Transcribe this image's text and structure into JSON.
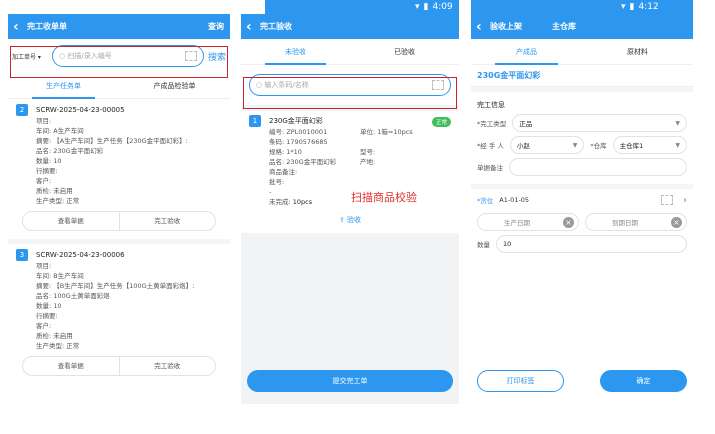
{
  "panel1": {
    "title": "完工收单单",
    "right_action": "查询",
    "dropdown": "加工单号",
    "search_placeholder": "扫描/录入编号",
    "search_btn": "搜索",
    "tabs": [
      "生产任务单",
      "产成品检验单"
    ],
    "cards": [
      {
        "index": "2",
        "code": "SCRW-2025-04-23-00005",
        "lines": [
          "项目:",
          "车间: A生产车间",
          "摘要: 【A生产车间】生产任务【230G金平面幻彩】:",
          "品名: 230G金平面幻彩",
          "数量: 10",
          "行摘要:",
          "客户:",
          "质检: 未启用",
          "生产类型: 正常"
        ],
        "btn_view": "查看单据",
        "btn_accept": "完工验收"
      },
      {
        "index": "3",
        "code": "SCRW-2025-04-23-00006",
        "lines": [
          "项目:",
          "车间: B生产车间",
          "摘要: 【B生产车间】生产任务【100G土黄单面彩烙】:",
          "品名: 100G土黄单面彩烙",
          "数量: 10",
          "行摘要:",
          "客户:",
          "质检: 未启用",
          "生产类型: 正常"
        ],
        "btn_view": "查看单据",
        "btn_accept": "完工验收"
      }
    ]
  },
  "panel2": {
    "status_time": "4:09",
    "title": "完工验收",
    "tabs": [
      "未验收",
      "已验收"
    ],
    "search_placeholder": "输入条码/名称",
    "item": {
      "index": "1",
      "name": "230G金平面幻彩",
      "tag": "正常",
      "code_label": "编号: ZPL0010001",
      "unit_label": "单位: 1箱=10pcs",
      "barcode": "条码: 1790576685",
      "spec": "规格: 1*10",
      "model": "型号:",
      "pname": "品名: 230G金平面幻彩",
      "origin": "产地:",
      "remark": "商品备注:",
      "batch": "批号:",
      "dash": "-",
      "unfinished_label": "未完成:",
      "unfinished_value": "10pcs"
    },
    "annotation": "扫描商品校验",
    "receive_link": "验收",
    "submit_btn": "提交完工单"
  },
  "panel3": {
    "status_time": "4:12",
    "title": "验收上架",
    "warehouse": "主仓库",
    "tabs": [
      "产成品",
      "原材料"
    ],
    "product": "230G金平面幻彩",
    "section": "完工信息",
    "type_label": "*完工类型",
    "type_value": "正品",
    "handler_label": "*经 手 人",
    "handler_value": "小赵",
    "store_label": "*仓库",
    "store_value": "主仓库1",
    "remark_label": "单据备注",
    "loc_label": "*货位",
    "loc_value": "A1-01-05",
    "prod_date": "生产日期",
    "exp_date": "到期日期",
    "qty_label": "数量",
    "qty_value": "10",
    "print_btn": "打印标签",
    "confirm_btn": "确定"
  }
}
